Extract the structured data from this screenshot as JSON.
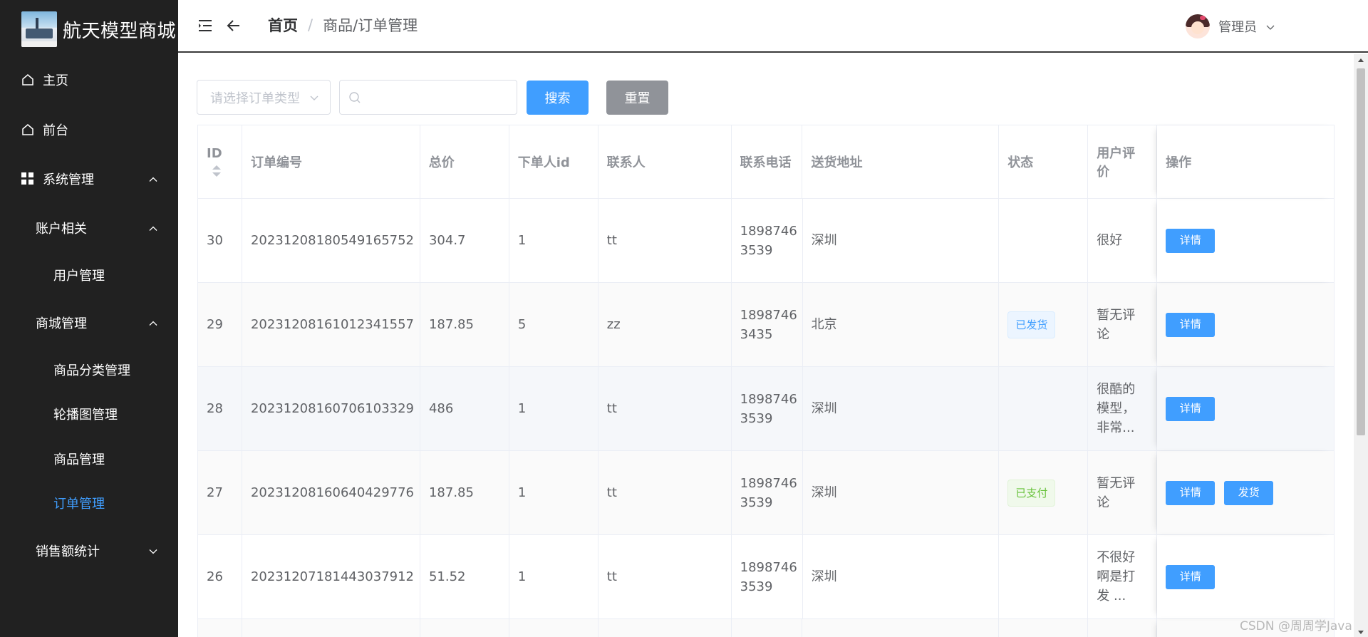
{
  "app": {
    "title": "航天模型商城"
  },
  "sidebar": {
    "items": [
      {
        "label": "主页"
      },
      {
        "label": "前台"
      },
      {
        "label": "系统管理"
      },
      {
        "label": "账户相关"
      },
      {
        "label": "用户管理"
      },
      {
        "label": "商城管理"
      },
      {
        "label": "商品分类管理"
      },
      {
        "label": "轮播图管理"
      },
      {
        "label": "商品管理"
      },
      {
        "label": "订单管理"
      },
      {
        "label": "销售额统计"
      }
    ],
    "active_color": "#409eff",
    "background": "#212121"
  },
  "header": {
    "breadcrumb_home": "首页",
    "breadcrumb_sep": "/",
    "breadcrumb_current": "商品/订单管理",
    "user_name": "管理员"
  },
  "filters": {
    "order_type_placeholder": "请选择订单类型",
    "search_value": "",
    "search_button": "搜索",
    "reset_button": "重置"
  },
  "table": {
    "headers": [
      "ID",
      "订单编号",
      "总价",
      "下单人id",
      "联系人",
      "联系电话",
      "送货地址",
      "状态",
      "用户评价",
      "操作"
    ],
    "rows": [
      {
        "id": "30",
        "order_no": "20231208180549165752",
        "total": "304.7",
        "user_id": "1",
        "contact": "tt",
        "phone_a": "1898746",
        "phone_b": "3539",
        "address": "深圳",
        "status": "",
        "comment": "很好",
        "actions": [
          "详情"
        ]
      },
      {
        "id": "29",
        "order_no": "20231208161012341557",
        "total": "187.85",
        "user_id": "5",
        "contact": "zz",
        "phone_a": "1898746",
        "phone_b": "3435",
        "address": "北京",
        "status": "已发货",
        "comment": "暂无评论",
        "actions": [
          "详情"
        ]
      },
      {
        "id": "28",
        "order_no": "20231208160706103329",
        "total": "486",
        "user_id": "1",
        "contact": "tt",
        "phone_a": "1898746",
        "phone_b": "3539",
        "address": "深圳",
        "status": "",
        "comment": "很酷的模型，非常...",
        "actions": [
          "详情"
        ]
      },
      {
        "id": "27",
        "order_no": "20231208160640429776",
        "total": "187.85",
        "user_id": "1",
        "contact": "tt",
        "phone_a": "1898746",
        "phone_b": "3539",
        "address": "深圳",
        "status": "已支付",
        "comment": "暂无评论",
        "actions": [
          "详情",
          "发货"
        ]
      },
      {
        "id": "26",
        "order_no": "20231207181443037912",
        "total": "51.52",
        "user_id": "1",
        "contact": "tt",
        "phone_a": "1898746",
        "phone_b": "3539",
        "address": "深圳",
        "status": "",
        "comment": "不很好啊是打发 ...",
        "actions": [
          "详情"
        ]
      }
    ],
    "status_colors": {
      "已发货": "#409eff",
      "已支付": "#67c23a"
    }
  },
  "watermark": "CSDN @周周学Java"
}
